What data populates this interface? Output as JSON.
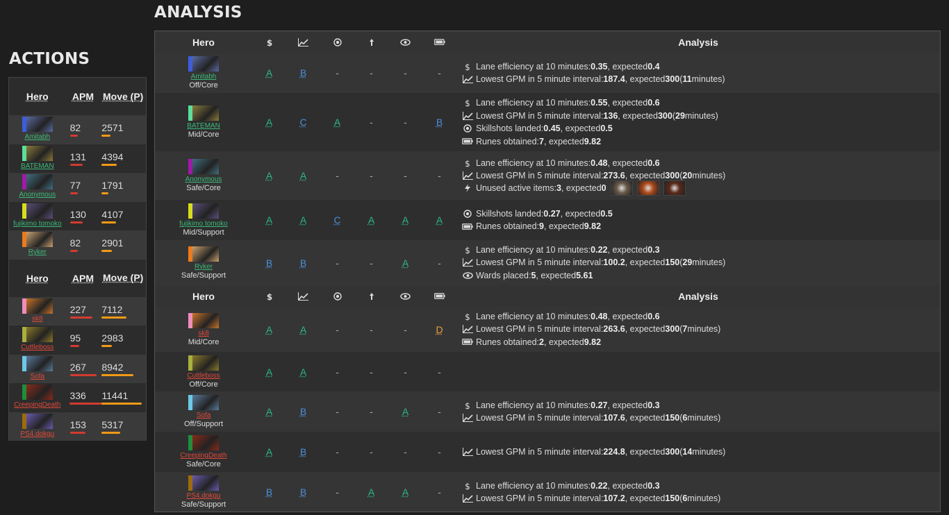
{
  "titles": {
    "actions": "ACTIONS",
    "analysis": "ANALYSIS"
  },
  "actions": {
    "headers": {
      "hero": "Hero",
      "apm": "APM",
      "move": "Move (P)"
    },
    "radiant": [
      {
        "name": "Amitabh",
        "apm": "82",
        "move": "2571",
        "color": "#3e5ddc",
        "portrait": "#5a6aa0",
        "apm_frac": 0.23,
        "move_frac": 0.22
      },
      {
        "name": "BATEMAN",
        "apm": "131",
        "move": "4394",
        "color": "#5cde9b",
        "portrait": "#8a7a3a",
        "apm_frac": 0.37,
        "move_frac": 0.38
      },
      {
        "name": "Anonymous",
        "apm": "77",
        "move": "1791",
        "color": "#a01aa8",
        "portrait": "#3f6f7e",
        "apm_frac": 0.22,
        "move_frac": 0.16
      },
      {
        "name": "fujikimo tomoko",
        "apm": "130",
        "move": "4107",
        "color": "#d7dd1c",
        "portrait": "#5a4e7a",
        "apm_frac": 0.37,
        "move_frac": 0.36
      },
      {
        "name": "Ryker",
        "apm": "82",
        "move": "2901",
        "color": "#ec7b1c",
        "portrait": "#c8a070",
        "apm_frac": 0.23,
        "move_frac": 0.25
      }
    ],
    "dire": [
      {
        "name": "sk8",
        "apm": "227",
        "move": "7112",
        "color": "#f08cbc",
        "portrait": "#c8742a",
        "apm_frac": 0.65,
        "move_frac": 0.62
      },
      {
        "name": "Cuttleboss",
        "apm": "95",
        "move": "2983",
        "color": "#a8b040",
        "portrait": "#8a7a2a",
        "apm_frac": 0.27,
        "move_frac": 0.26
      },
      {
        "name": "Sofa",
        "apm": "267",
        "move": "8942",
        "color": "#6ec8e8",
        "portrait": "#5a7a9a",
        "apm_frac": 0.76,
        "move_frac": 0.78
      },
      {
        "name": "CreepingDeath",
        "apm": "336",
        "move": "11441",
        "color": "#1e8e3c",
        "portrait": "#8a2a1a",
        "apm_frac": 0.96,
        "move_frac": 1.0
      },
      {
        "name": "PS4.dokgu",
        "apm": "153",
        "move": "5317",
        "color": "#9c6c0c",
        "portrait": "#6a5ab0",
        "apm_frac": 0.44,
        "move_frac": 0.46
      }
    ]
  },
  "analysis": {
    "headers": {
      "hero": "Hero",
      "analysis": "Analysis",
      "icons": [
        "dollar-icon",
        "chart-icon",
        "target-icon",
        "arrow-icon",
        "eye-icon",
        "battery-icon"
      ],
      "symbols": [
        "$",
        "📈",
        "◎",
        "↥",
        "👁",
        "▭"
      ]
    },
    "radiant": [
      {
        "name": "Amitabh",
        "role": "Off/Core",
        "color": "#3e5ddc",
        "portrait": "#5a6aa0",
        "grades": [
          "A",
          "B",
          "-",
          "-",
          "-",
          "-"
        ],
        "lines": [
          {
            "icon": "dollar-icon",
            "sym": "$",
            "text": "Lane efficiency at 10 minutes: ",
            "v1": "0.35",
            ", expected ": ", expected ",
            "v2": "0.4",
            "tail": ""
          },
          {
            "icon": "chart-icon",
            "sym": "📈",
            "text": "Lowest GPM in 5 minute interval: ",
            "v1": "187.4",
            ", expected ": ", expected ",
            "v2": "300",
            "tail": " (11 minutes)"
          }
        ]
      },
      {
        "name": "BATEMAN",
        "role": "Mid/Core",
        "color": "#5cde9b",
        "portrait": "#8a7a3a",
        "grades": [
          "A",
          "C",
          "A",
          "-",
          "-",
          "B"
        ],
        "lines": [
          {
            "icon": "dollar-icon",
            "sym": "$",
            "text": "Lane efficiency at 10 minutes: ",
            "v1": "0.55",
            ", expected ": ", expected ",
            "v2": "0.6",
            "tail": ""
          },
          {
            "icon": "chart-icon",
            "sym": "📈",
            "text": "Lowest GPM in 5 minute interval: ",
            "v1": "136",
            ", expected ": ", expected ",
            "v2": "300",
            "tail": " (29 minutes)"
          },
          {
            "icon": "target-icon",
            "sym": "◎",
            "text": "Skillshots landed: ",
            "v1": "0.45",
            ", expected ": ", expected ",
            "v2": "0.5",
            "tail": ""
          },
          {
            "icon": "battery-icon",
            "sym": "▭",
            "text": "Runes obtained: ",
            "v1": "7",
            ", expected ": ", expected ",
            "v2": "9.82",
            "tail": ""
          }
        ]
      },
      {
        "name": "Anonymous",
        "role": "Safe/Core",
        "color": "#a01aa8",
        "portrait": "#3f6f7e",
        "grades": [
          "A",
          "A",
          "-",
          "-",
          "-",
          "-"
        ],
        "lines": [
          {
            "icon": "dollar-icon",
            "sym": "$",
            "text": "Lane efficiency at 10 minutes: ",
            "v1": "0.48",
            ", expected ": ", expected ",
            "v2": "0.6",
            "tail": ""
          },
          {
            "icon": "chart-icon",
            "sym": "📈",
            "text": "Lowest GPM in 5 minute interval: ",
            "v1": "273.6",
            ", expected ": ", expected ",
            "v2": "300",
            "tail": " (20 minutes)"
          },
          {
            "icon": "lightning-icon",
            "sym": "ϟ",
            "text": "Unused active items: ",
            "v1": "3",
            ", expected ": ", expected ",
            "v2": "0",
            "tail": "",
            "items": [
              "#6a5a4a",
              "#b04a1a",
              "#5a2a1a"
            ]
          }
        ]
      },
      {
        "name": "fujikimo tomoko",
        "role": "Mid/Support",
        "color": "#d7dd1c",
        "portrait": "#5a4e7a",
        "grades": [
          "A",
          "A",
          "C",
          "A",
          "A",
          "A"
        ],
        "lines": [
          {
            "icon": "target-icon",
            "sym": "◎",
            "text": "Skillshots landed: ",
            "v1": "0.27",
            ", expected ": ", expected ",
            "v2": "0.5",
            "tail": ""
          },
          {
            "icon": "battery-icon",
            "sym": "▭",
            "text": "Runes obtained: ",
            "v1": "9",
            ", expected ": ", expected ",
            "v2": "9.82",
            "tail": ""
          }
        ]
      },
      {
        "name": "Ryker",
        "role": "Safe/Support",
        "color": "#ec7b1c",
        "portrait": "#c8a070",
        "grades": [
          "B",
          "B",
          "-",
          "-",
          "A",
          "-"
        ],
        "lines": [
          {
            "icon": "dollar-icon",
            "sym": "$",
            "text": "Lane efficiency at 10 minutes: ",
            "v1": "0.22",
            ", expected ": ", expected ",
            "v2": "0.3",
            "tail": ""
          },
          {
            "icon": "chart-icon",
            "sym": "📈",
            "text": "Lowest GPM in 5 minute interval: ",
            "v1": "100.2",
            ", expected ": ", expected ",
            "v2": "150",
            "tail": " (29 minutes)"
          },
          {
            "icon": "eye-icon",
            "sym": "👁",
            "text": "Wards placed: ",
            "v1": "5",
            ", expected ": ", expected ",
            "v2": "5.61",
            "tail": ""
          }
        ]
      }
    ],
    "dire": [
      {
        "name": "sk8",
        "role": "Mid/Core",
        "color": "#f08cbc",
        "portrait": "#c8742a",
        "grades": [
          "A",
          "A",
          "-",
          "-",
          "-",
          "D"
        ],
        "lines": [
          {
            "icon": "dollar-icon",
            "sym": "$",
            "text": "Lane efficiency at 10 minutes: ",
            "v1": "0.48",
            ", expected ": ", expected ",
            "v2": "0.6",
            "tail": ""
          },
          {
            "icon": "chart-icon",
            "sym": "📈",
            "text": "Lowest GPM in 5 minute interval: ",
            "v1": "263.6",
            ", expected ": ", expected ",
            "v2": "300",
            "tail": " (7 minutes)"
          },
          {
            "icon": "battery-icon",
            "sym": "▭",
            "text": "Runes obtained: ",
            "v1": "2",
            ", expected ": ", expected ",
            "v2": "9.82",
            "tail": ""
          }
        ]
      },
      {
        "name": "Cuttleboss",
        "role": "Off/Core",
        "color": "#a8b040",
        "portrait": "#8a7a2a",
        "grades": [
          "A",
          "A",
          "-",
          "-",
          "-",
          "-"
        ],
        "lines": []
      },
      {
        "name": "Sofa",
        "role": "Off/Support",
        "color": "#6ec8e8",
        "portrait": "#5a7a9a",
        "grades": [
          "A",
          "B",
          "-",
          "-",
          "A",
          "-"
        ],
        "lines": [
          {
            "icon": "dollar-icon",
            "sym": "$",
            "text": "Lane efficiency at 10 minutes: ",
            "v1": "0.27",
            ", expected ": ", expected ",
            "v2": "0.3",
            "tail": ""
          },
          {
            "icon": "chart-icon",
            "sym": "📈",
            "text": "Lowest GPM in 5 minute interval: ",
            "v1": "107.6",
            ", expected ": ", expected ",
            "v2": "150",
            "tail": " (6 minutes)"
          }
        ]
      },
      {
        "name": "CreepingDeath",
        "role": "Safe/Core",
        "color": "#1e8e3c",
        "portrait": "#8a2a1a",
        "grades": [
          "A",
          "B",
          "-",
          "-",
          "-",
          "-"
        ],
        "lines": [
          {
            "icon": "chart-icon",
            "sym": "📈",
            "text": "Lowest GPM in 5 minute interval: ",
            "v1": "224.8",
            ", expected ": ", expected ",
            "v2": "300",
            "tail": " (14 minutes)"
          }
        ]
      },
      {
        "name": "PS4.dokgu",
        "role": "Safe/Support",
        "color": "#9c6c0c",
        "portrait": "#6a5ab0",
        "grades": [
          "B",
          "B",
          "-",
          "A",
          "A",
          "-"
        ],
        "lines": [
          {
            "icon": "dollar-icon",
            "sym": "$",
            "text": "Lane efficiency at 10 minutes: ",
            "v1": "0.22",
            ", expected ": ", expected ",
            "v2": "0.3",
            "tail": ""
          },
          {
            "icon": "chart-icon",
            "sym": "📈",
            "text": "Lowest GPM in 5 minute interval: ",
            "v1": "107.2",
            ", expected ": ", expected ",
            "v2": "150",
            "tail": " (6 minutes)"
          }
        ]
      }
    ]
  }
}
